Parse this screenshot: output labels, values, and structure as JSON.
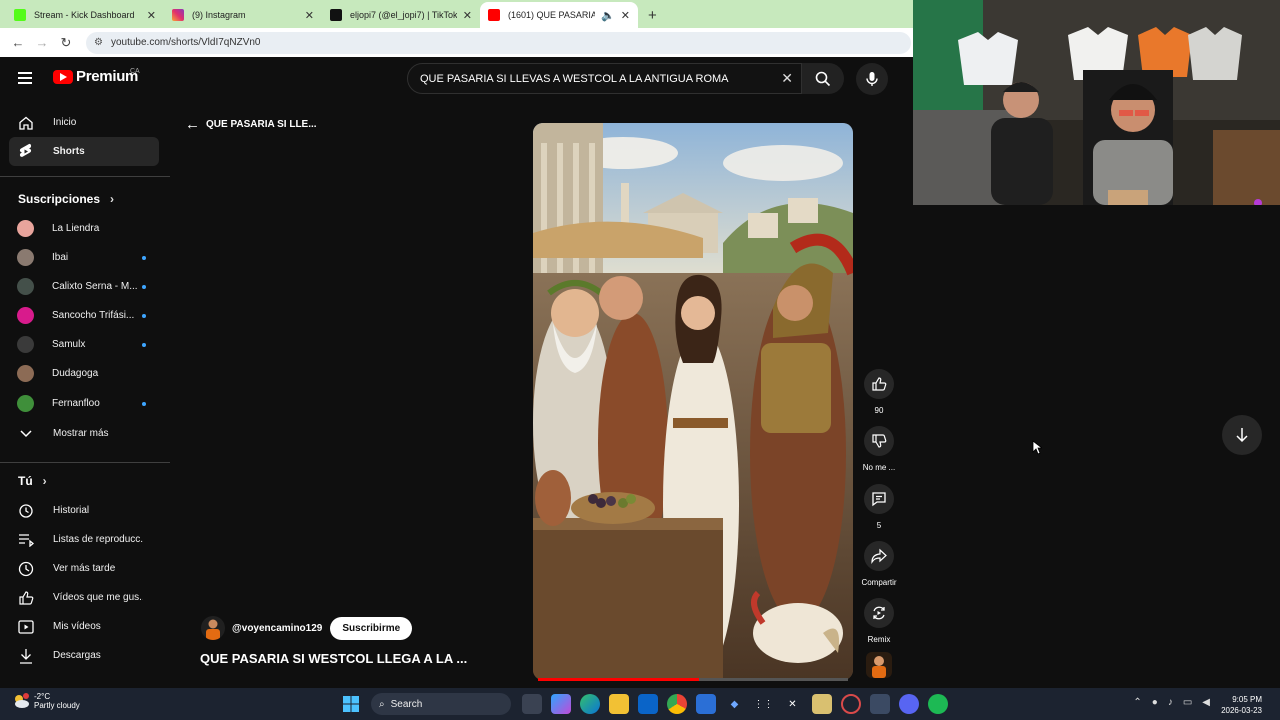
{
  "browser": {
    "tabs": [
      {
        "label": "Stream - Kick Dashboard",
        "color": "#53fc18",
        "active": false
      },
      {
        "label": "(9) Instagram",
        "color": "#e1306c",
        "active": false
      },
      {
        "label": "eljopi7 (@el_jopi7) | TikTok",
        "color": "#111111",
        "active": false
      },
      {
        "label": "(1601) QUE PASARIA SI WE",
        "color": "#ff0000",
        "active": true
      }
    ],
    "url": "youtube.com/shorts/VldI7qNZVn0"
  },
  "header": {
    "logo_text": "Premium",
    "country": "CA",
    "search_value": "QUE PASARIA SI LLEVAS A WESTCOL A LA ANTIGUA ROMA"
  },
  "sidebar": {
    "main": [
      {
        "label": "Inicio",
        "icon": "home-icon"
      },
      {
        "label": "Shorts",
        "icon": "shorts-icon"
      }
    ],
    "subs_title": "Suscripciones",
    "subs": [
      {
        "label": "La Liendra",
        "color": "#e8a49c",
        "dot": false
      },
      {
        "label": "Ibai",
        "color": "#8a7a70",
        "dot": true
      },
      {
        "label": "Calixto Serna - M...",
        "color": "#44504a",
        "dot": true
      },
      {
        "label": "Sancocho Trifási...",
        "color": "#d81b8c",
        "dot": true
      },
      {
        "label": "Samulx",
        "color": "#3a3a3a",
        "dot": true
      },
      {
        "label": "Dudagoga",
        "color": "#8c6b55",
        "dot": false
      },
      {
        "label": "Fernanfloo",
        "color": "#3f8f3a",
        "dot": true
      }
    ],
    "show_more": "Mostrar más",
    "you_title": "Tú",
    "you": [
      {
        "label": "Historial",
        "icon": "history-icon"
      },
      {
        "label": "Listas de reproducc...",
        "icon": "playlist-icon"
      },
      {
        "label": "Ver más tarde",
        "icon": "clock-icon"
      },
      {
        "label": "Vídeos que me gus...",
        "icon": "like-icon"
      },
      {
        "label": "Mis vídeos",
        "icon": "video-icon"
      },
      {
        "label": "Descargas",
        "icon": "download-icon"
      }
    ]
  },
  "short": {
    "back_title": "QUE PASARIA SI LLE...",
    "channel": "@voyencamino129",
    "subscribe": "Suscribirme",
    "title": "QUE PASARIA SI WESTCOL LLEGA A LA ...",
    "progress": 0.52,
    "likes": "90",
    "dislike_label": "No me ...",
    "comments": "5",
    "share_label": "Compartir",
    "remix_label": "Remix"
  },
  "taskbar": {
    "temp": "-2°C",
    "weather": "Partly cloudy",
    "search": "Search",
    "time": "9:05 PM",
    "date": "2026-03-23"
  }
}
